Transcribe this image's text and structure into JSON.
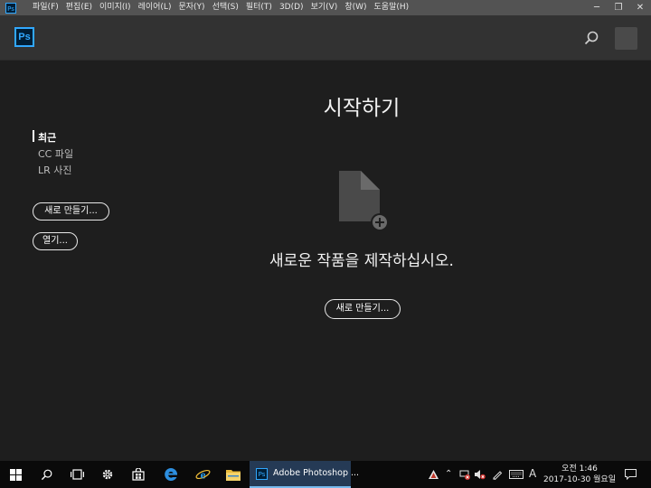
{
  "menubar": {
    "app_icon": "Ps",
    "items": [
      "파일(F)",
      "편집(E)",
      "이미지(I)",
      "레이어(L)",
      "문자(Y)",
      "선택(S)",
      "필터(T)",
      "3D(D)",
      "보기(V)",
      "창(W)",
      "도움말(H)"
    ],
    "window_controls": [
      "─",
      "❐",
      "✕"
    ]
  },
  "appbar": {
    "logo": "Ps",
    "icons": [
      "search-icon",
      "avatar"
    ]
  },
  "sidebar": {
    "items": [
      {
        "label": "최근",
        "active": true
      },
      {
        "label": "CC 파일",
        "active": false
      },
      {
        "label": "LR 사진",
        "active": false
      }
    ],
    "new_button": "새로 만들기...",
    "open_button": "열기..."
  },
  "main": {
    "title": "시작하기",
    "headline": "새로운 작품을 제작하십시오.",
    "new_button": "새로 만들기...",
    "icon": "new-document-icon"
  },
  "taskbar": {
    "active_app": "Adobe Photoshop ...",
    "active_app_icon": "Ps",
    "tray_lang": "A",
    "clock": {
      "time": "오전 1:46",
      "date": "2017-10-30 월요일"
    }
  },
  "colors": {
    "accent": "#31a8ff",
    "background": "#1e1e1e",
    "menubar": "#535353",
    "header": "#323232"
  }
}
